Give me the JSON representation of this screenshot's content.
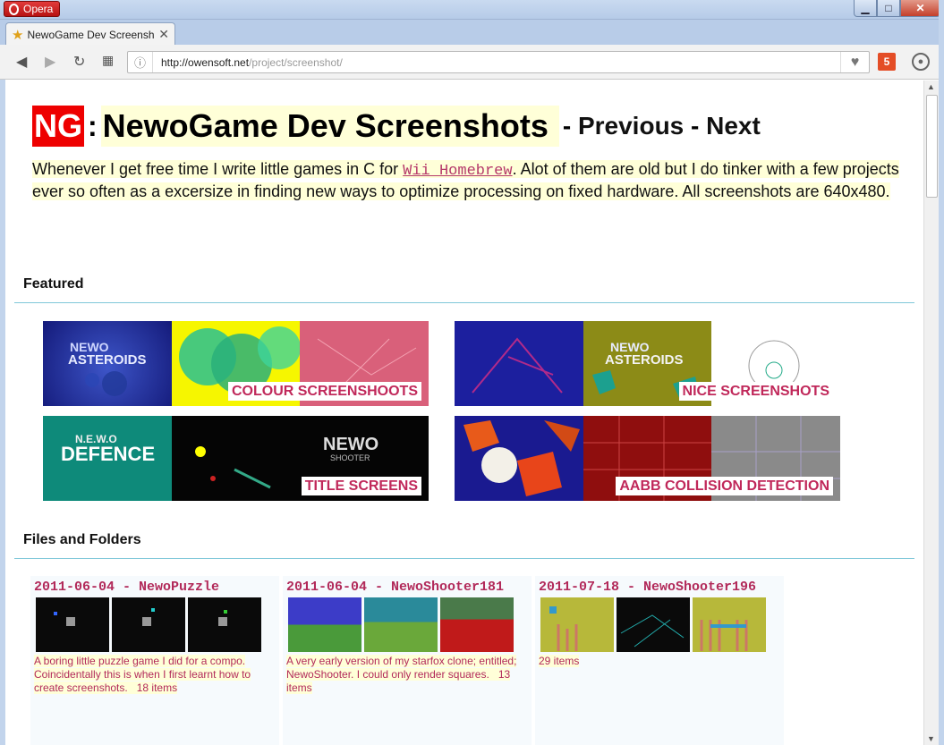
{
  "window": {
    "app_button": "Opera",
    "min_icon": "minimize-icon",
    "max_icon": "maximize-icon",
    "close_icon": "close-icon"
  },
  "tabs": [
    {
      "title": "NewoGame Dev Screenshots",
      "icon": "star-icon"
    }
  ],
  "toolbar": {
    "url_host": "http://owensoft.net",
    "url_path": "/project/screenshot/"
  },
  "page": {
    "logo": "NG",
    "colon": ":",
    "title": "NewoGame Dev Screenshots",
    "sep1": " - ",
    "prev": "Previous",
    "sep2": " - ",
    "next": "Next",
    "intro_a": "Whenever I get free time I write little games in C for ",
    "intro_code": "Wii Homebrew",
    "intro_b": ". Alot of them are old but I do tinker with a few projects ever so often as a excersize in finding new ways to optimize processing on fixed hardware. All screenshots are 640x480.",
    "featured_heading": "Featured",
    "files_heading": "Files and Folders"
  },
  "featured": [
    {
      "label": "COLOUR SCREENSHOOTS"
    },
    {
      "label": "NICE SCREENSHOTS"
    },
    {
      "label": "TITLE SCREENS"
    },
    {
      "label": "AABB COLLISION DETECTION"
    }
  ],
  "folders": [
    {
      "name": "2011-06-04 - NewoPuzzle",
      "desc": "A boring little puzzle game I did for a compo. Coincidentally this is when I first learnt how to create screenshots.",
      "count": "18 items"
    },
    {
      "name": "2011-06-04 - NewoShooter181",
      "desc": "A very early version of my starfox clone; entitled; NewoShooter. I could only render squares.",
      "count": "13 items"
    },
    {
      "name": "2011-07-18 - NewoShooter196",
      "desc": "",
      "count": "29 items"
    }
  ],
  "colors": {
    "accent_magenta": "#c0285a",
    "highlight_yellow": "#ffffd8",
    "logo_red": "#ee0000",
    "rule_cyan": "#7fc7d9"
  }
}
